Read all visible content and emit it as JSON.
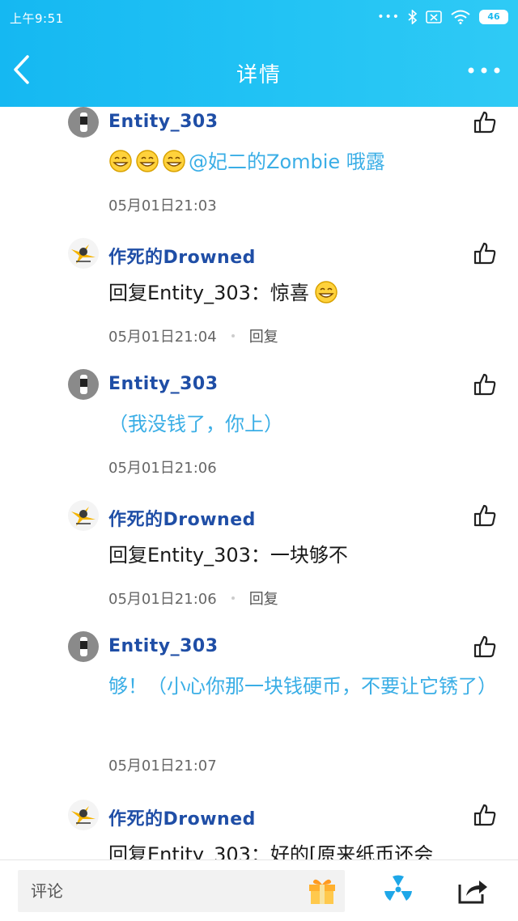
{
  "status_bar": {
    "time": "上午9:51",
    "battery": "46",
    "icons": [
      "more-dots-icon",
      "bluetooth-icon",
      "sim-icon",
      "wifi-icon",
      "battery-icon"
    ]
  },
  "header": {
    "title": "详情",
    "back_icon": "chevron-left-icon",
    "more_icon": "more-dots-icon",
    "color": "#1cbdf3"
  },
  "comments": [
    {
      "user": "Entity_303",
      "text_parts": [
        "@妃二的Zombie",
        " 哦露"
      ],
      "emoji_count": 3,
      "time": "05月01日21:03",
      "reply": ""
    },
    {
      "user": "作死的Drowned",
      "text": "回复Entity_303：惊喜",
      "emoji_count": 1,
      "time": "05月01日21:04",
      "reply": "回复"
    },
    {
      "user": "Entity_303",
      "text": "（我没钱了，你上）",
      "time": "05月01日21:06",
      "reply": ""
    },
    {
      "user": "作死的Drowned",
      "text": "回复Entity_303：一块够不",
      "time": "05月01日21:06",
      "reply": "回复"
    },
    {
      "user": "Entity_303",
      "text": "够！（小心你那一块钱硬币，不要让它锈了）",
      "time": "05月01日21:07",
      "reply": ""
    },
    {
      "user": "作死的Drowned",
      "text": "回复Entity_303：好的[原来纸币还会",
      "time": "",
      "reply": ""
    }
  ],
  "bottom_bar": {
    "input_placeholder": "评论",
    "icons": [
      "gift-icon",
      "radiation-icon",
      "share-icon"
    ]
  }
}
